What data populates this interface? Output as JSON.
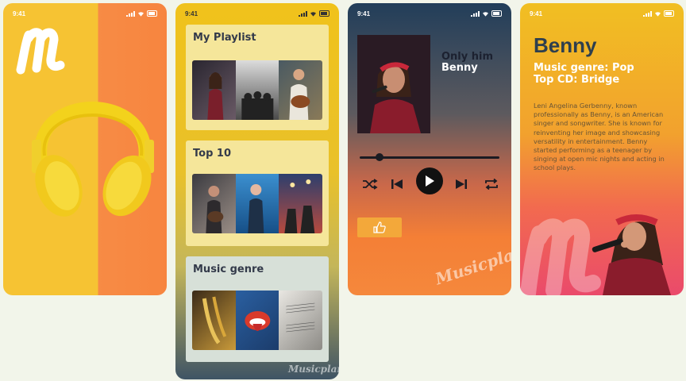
{
  "status_time": "9:41",
  "phone2": {
    "cards": [
      {
        "title": "My Playlist"
      },
      {
        "title": "Top 10"
      },
      {
        "title": "Music genre"
      }
    ],
    "watermark": "Musicplan"
  },
  "phone3": {
    "song_title": "Only him",
    "artist": "Benny",
    "progress": 0.14,
    "watermark": "Musicplan"
  },
  "phone4": {
    "name": "Benny",
    "genre_line": "Music genre: Pop",
    "top_cd_line": "Top CD: Bridge",
    "bio": "Leni Angelina Gerbenny, known professionally as Benny, is an American singer and songwriter. She is known for reinventing her image and showcasing versatility in entertainment. Benny started performing as a teenager by singing at open mic nights and acting in school plays."
  },
  "icons": [
    "cellular-signal-icon",
    "wifi-icon",
    "battery-icon",
    "musicplan-m-logo",
    "headphones-image",
    "shuffle-icon",
    "previous-icon",
    "play-icon",
    "next-icon",
    "repeat-icon",
    "thumbs-up-icon"
  ],
  "colors": {
    "accent_yellow": "#f6c333",
    "accent_orange": "#f78b45",
    "dark_text": "#333a4a",
    "play_button": "#111111"
  }
}
